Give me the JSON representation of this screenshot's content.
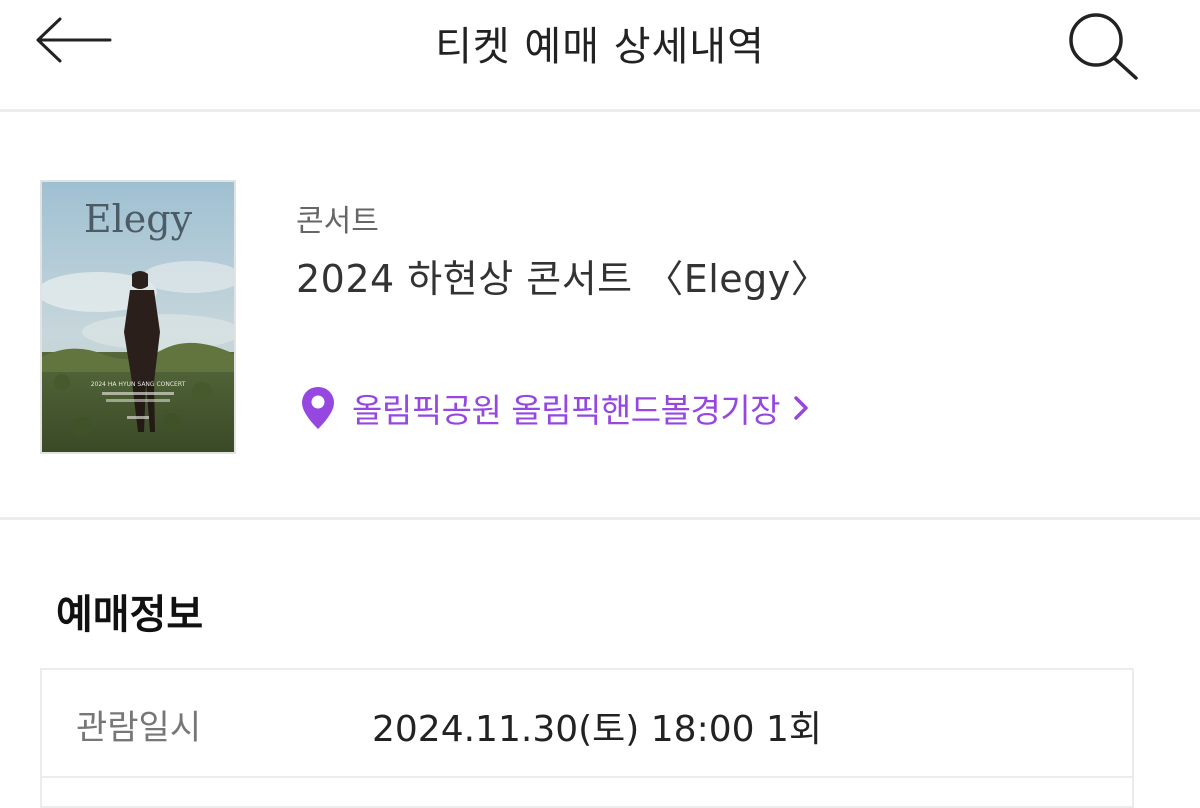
{
  "header": {
    "title": "티켓 예매 상세내역",
    "back_icon": "arrow-left-icon",
    "search_icon": "search-icon"
  },
  "event": {
    "category": "콘서트",
    "title": "2024 하현상 콘서트 〈Elegy〉",
    "poster": {
      "title_text": "Elegy",
      "caption_text": "2024 HA HYUN SANG CONCERT"
    },
    "venue": {
      "name": "올림픽공원 올림픽핸드볼경기장",
      "icon": "location-pin-icon",
      "chevron_icon": "chevron-right-icon"
    }
  },
  "booking_info": {
    "section_title": "예매정보",
    "rows": [
      {
        "label": "관람일시",
        "value": "2024.11.30(토) 18:00 1회"
      }
    ]
  },
  "colors": {
    "accent": "#9547e0",
    "divider": "#ededed",
    "text_primary": "#222222",
    "text_secondary": "#777777"
  }
}
